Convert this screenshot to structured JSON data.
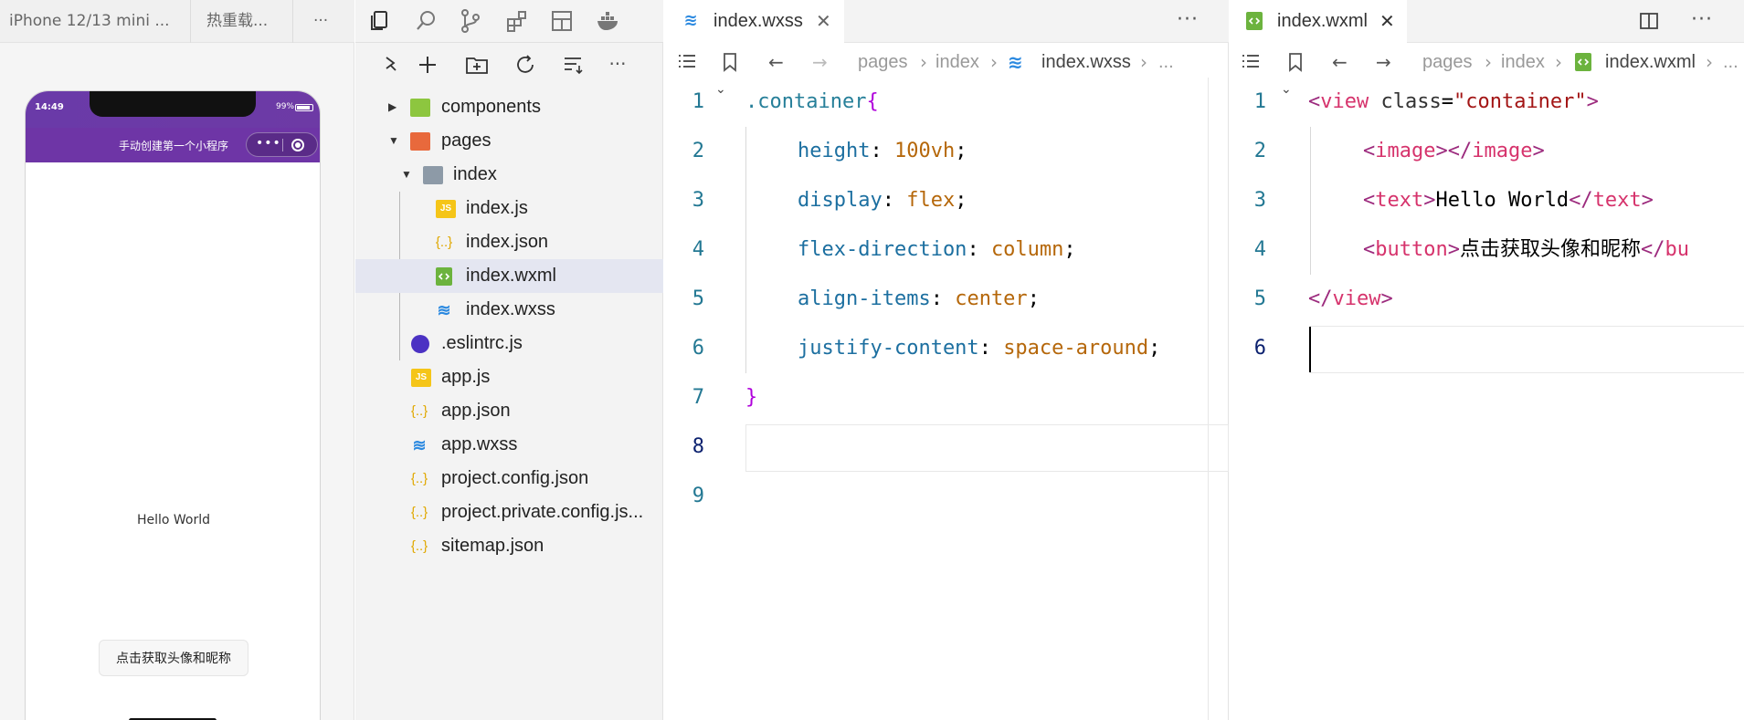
{
  "simulator": {
    "tabs": [
      {
        "label": "iPhone 12/13 mini ..."
      },
      {
        "label": "热重载..."
      }
    ],
    "more_label": "···",
    "status_time": "14:49",
    "battery": "99%",
    "nav_title": "手动创建第一个小程序",
    "capsule_dots": "•••",
    "hello_text": "Hello World",
    "button_label": "点击获取头像和昵称"
  },
  "explorer": {
    "toolbar_more": "···",
    "tree": [
      {
        "label": "components",
        "type": "folder",
        "arrow": "▶"
      },
      {
        "label": "pages",
        "type": "folder-pages",
        "arrow": "▼"
      },
      {
        "label": "index",
        "type": "folder-open",
        "arrow": "▼"
      },
      {
        "label": "index.js",
        "type": "js"
      },
      {
        "label": "index.json",
        "type": "json"
      },
      {
        "label": "index.wxml",
        "type": "wxml"
      },
      {
        "label": "index.wxss",
        "type": "wxss"
      },
      {
        "label": ".eslintrc.js",
        "type": "eslint"
      },
      {
        "label": "app.js",
        "type": "js"
      },
      {
        "label": "app.json",
        "type": "json"
      },
      {
        "label": "app.wxss",
        "type": "wxss"
      },
      {
        "label": "project.config.json",
        "type": "json"
      },
      {
        "label": "project.private.config.js...",
        "type": "json"
      },
      {
        "label": "sitemap.json",
        "type": "json"
      }
    ],
    "icons": {
      "js": "JS",
      "json": "{..}",
      "wxss": "≋"
    }
  },
  "editor1": {
    "tab_label": "index.wxss",
    "close": "✕",
    "more": "···",
    "breadcrumb": [
      "pages",
      "index",
      "index.wxss",
      "..."
    ],
    "line_numbers": [
      "1",
      "2",
      "3",
      "4",
      "5",
      "6",
      "7",
      "8",
      "9"
    ],
    "code": {
      "l1_sel": ".container",
      "l1_brace": "{",
      "l2_prop": "height",
      "l2_val": "100vh",
      "l3_prop": "display",
      "l3_val": "flex",
      "l4_prop": "flex-direction",
      "l4_val": "column",
      "l5_prop": "align-items",
      "l5_val": "center",
      "l6_prop": "justify-content",
      "l6_val": "space-around",
      "l7_brace": "}"
    }
  },
  "editor2": {
    "tab_label": "index.wxml",
    "close": "✕",
    "more": "···",
    "breadcrumb": [
      "pages",
      "index",
      "index.wxml",
      "..."
    ],
    "line_numbers": [
      "1",
      "2",
      "3",
      "4",
      "5",
      "6"
    ],
    "code": {
      "l1_tag": "view",
      "l1_attr": "class",
      "l1_str": "\"container\"",
      "l2_open": "image",
      "l2_close": "image",
      "l3_open": "text",
      "l3_text": "Hello World",
      "l3_close": "text",
      "l4_open": "button",
      "l4_text": "点击获取头像和昵称",
      "l4_close": "bu",
      "l5_tag": "view"
    }
  }
}
